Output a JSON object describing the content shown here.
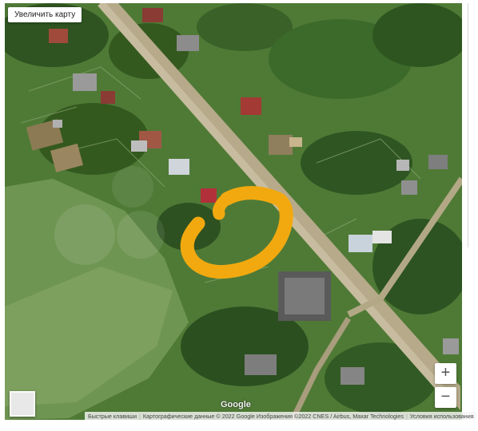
{
  "controls": {
    "enlarge_label": "Увеличить карту",
    "zoom_in_label": "+",
    "zoom_out_label": "−"
  },
  "branding": {
    "logo_text": "Google"
  },
  "attribution": {
    "shortcuts": "Быстрые клавиши",
    "map_data": "Картографические данные © 2022 Google Изображения ©2022 CNES / Airbus, Maxar Technologies",
    "terms": "Условия использования"
  },
  "colors": {
    "marker": "#f2a90f",
    "road": "#b9ab8b",
    "vegetation": "#3d6628"
  },
  "icons": {
    "view_toggle": "satellite-layer-icon"
  }
}
